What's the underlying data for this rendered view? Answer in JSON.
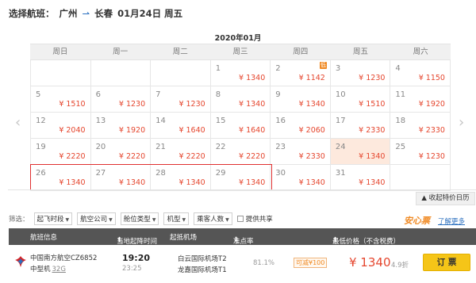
{
  "route": {
    "prefix": "选择航班：",
    "from": "广州",
    "to": "长春",
    "date": "01月24日 周五"
  },
  "calendar": {
    "month_title": "2020年01月",
    "weekdays": [
      "周日",
      "周一",
      "周二",
      "周三",
      "周四",
      "周五",
      "周六"
    ],
    "low_badge": "低",
    "cells": [
      {
        "day": "",
        "price": ""
      },
      {
        "day": "",
        "price": ""
      },
      {
        "day": "",
        "price": ""
      },
      {
        "day": "1",
        "price": "¥ 1340"
      },
      {
        "day": "2",
        "price": "¥ 1142",
        "low": true
      },
      {
        "day": "3",
        "price": "¥ 1230"
      },
      {
        "day": "4",
        "price": "¥ 1150"
      },
      {
        "day": "5",
        "price": "¥ 1510"
      },
      {
        "day": "6",
        "price": "¥ 1230"
      },
      {
        "day": "7",
        "price": "¥ 1230"
      },
      {
        "day": "8",
        "price": "¥ 1340"
      },
      {
        "day": "9",
        "price": "¥ 1340"
      },
      {
        "day": "10",
        "price": "¥ 1510"
      },
      {
        "day": "11",
        "price": "¥ 1920"
      },
      {
        "day": "12",
        "price": "¥ 2040"
      },
      {
        "day": "13",
        "price": "¥ 1920"
      },
      {
        "day": "14",
        "price": "¥ 1640"
      },
      {
        "day": "15",
        "price": "¥ 1640"
      },
      {
        "day": "16",
        "price": "¥ 2060"
      },
      {
        "day": "17",
        "price": "¥ 2330"
      },
      {
        "day": "18",
        "price": "¥ 2330"
      },
      {
        "day": "19",
        "price": "¥ 2220"
      },
      {
        "day": "20",
        "price": "¥ 2220"
      },
      {
        "day": "21",
        "price": "¥ 2220"
      },
      {
        "day": "22",
        "price": "¥ 2220"
      },
      {
        "day": "23",
        "price": "¥ 2330"
      },
      {
        "day": "24",
        "price": "¥ 1340",
        "selected": true
      },
      {
        "day": "25",
        "price": "¥ 1230"
      },
      {
        "day": "26",
        "price": "¥ 1340"
      },
      {
        "day": "27",
        "price": "¥ 1340"
      },
      {
        "day": "28",
        "price": "¥ 1340"
      },
      {
        "day": "29",
        "price": "¥ 1340"
      },
      {
        "day": "30",
        "price": "¥ 1340"
      },
      {
        "day": "31",
        "price": "¥ 1340"
      },
      {
        "day": "",
        "price": ""
      }
    ],
    "prev_icon": "‹",
    "next_icon": "›",
    "collapse_label": "收起特价日历",
    "collapse_icon": "▲"
  },
  "filters": {
    "label": "筛选：",
    "items": [
      "起飞时段",
      "航空公司",
      "舱位类型",
      "机型",
      "乘客人数"
    ],
    "share_label": "提供共享"
  },
  "promo": {
    "anxin": "安心票",
    "learn_more": "了解更多"
  },
  "table": {
    "headers": {
      "flight": "航班信息",
      "time": "当地起降时间",
      "airport": "起抵机场",
      "ontime": "准点率",
      "price": "最低价格（不含税费）"
    },
    "rows": [
      {
        "airline": "中国南方航空CZ6852",
        "aircraft": "中型机",
        "aircraft_code": "32G",
        "dep_time": "19:20",
        "arr_time": "23:25",
        "dep_airport": "白云国际机场T2",
        "arr_airport": "龙嘉国际机场T1",
        "ontime_rate": "81.1%",
        "tag": "可减¥100",
        "price": "¥ 1340",
        "discount": "4.9折",
        "book_label": "订 票"
      }
    ]
  },
  "colors": {
    "price_red": "#e5462e",
    "accent_orange": "#f08a24",
    "book_yellow": "#f5c518",
    "highlight_red": "#e03030"
  }
}
